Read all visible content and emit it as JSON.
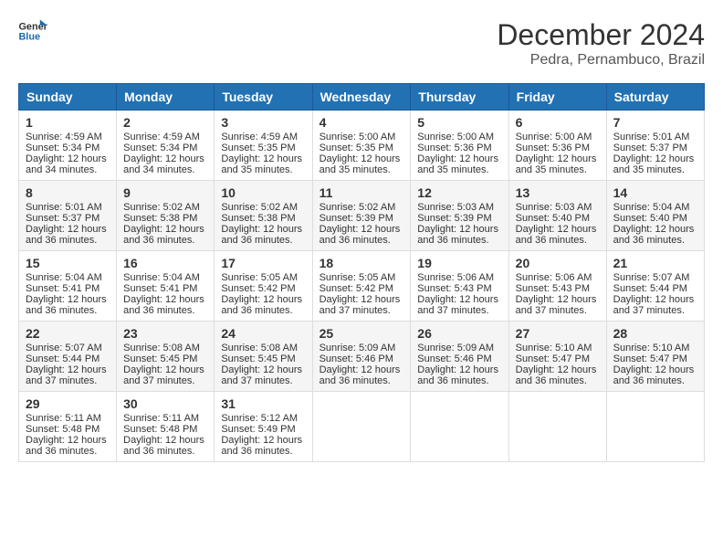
{
  "logo": {
    "line1": "General",
    "line2": "Blue"
  },
  "title": {
    "month": "December 2024",
    "location": "Pedra, Pernambuco, Brazil"
  },
  "headers": [
    "Sunday",
    "Monday",
    "Tuesday",
    "Wednesday",
    "Thursday",
    "Friday",
    "Saturday"
  ],
  "weeks": [
    [
      {
        "day": 1,
        "sunrise": "4:59 AM",
        "sunset": "5:34 PM",
        "daylight": "12 hours and 34 minutes."
      },
      {
        "day": 2,
        "sunrise": "4:59 AM",
        "sunset": "5:34 PM",
        "daylight": "12 hours and 34 minutes."
      },
      {
        "day": 3,
        "sunrise": "4:59 AM",
        "sunset": "5:35 PM",
        "daylight": "12 hours and 35 minutes."
      },
      {
        "day": 4,
        "sunrise": "5:00 AM",
        "sunset": "5:35 PM",
        "daylight": "12 hours and 35 minutes."
      },
      {
        "day": 5,
        "sunrise": "5:00 AM",
        "sunset": "5:36 PM",
        "daylight": "12 hours and 35 minutes."
      },
      {
        "day": 6,
        "sunrise": "5:00 AM",
        "sunset": "5:36 PM",
        "daylight": "12 hours and 35 minutes."
      },
      {
        "day": 7,
        "sunrise": "5:01 AM",
        "sunset": "5:37 PM",
        "daylight": "12 hours and 35 minutes."
      }
    ],
    [
      {
        "day": 8,
        "sunrise": "5:01 AM",
        "sunset": "5:37 PM",
        "daylight": "12 hours and 36 minutes."
      },
      {
        "day": 9,
        "sunrise": "5:02 AM",
        "sunset": "5:38 PM",
        "daylight": "12 hours and 36 minutes."
      },
      {
        "day": 10,
        "sunrise": "5:02 AM",
        "sunset": "5:38 PM",
        "daylight": "12 hours and 36 minutes."
      },
      {
        "day": 11,
        "sunrise": "5:02 AM",
        "sunset": "5:39 PM",
        "daylight": "12 hours and 36 minutes."
      },
      {
        "day": 12,
        "sunrise": "5:03 AM",
        "sunset": "5:39 PM",
        "daylight": "12 hours and 36 minutes."
      },
      {
        "day": 13,
        "sunrise": "5:03 AM",
        "sunset": "5:40 PM",
        "daylight": "12 hours and 36 minutes."
      },
      {
        "day": 14,
        "sunrise": "5:04 AM",
        "sunset": "5:40 PM",
        "daylight": "12 hours and 36 minutes."
      }
    ],
    [
      {
        "day": 15,
        "sunrise": "5:04 AM",
        "sunset": "5:41 PM",
        "daylight": "12 hours and 36 minutes."
      },
      {
        "day": 16,
        "sunrise": "5:04 AM",
        "sunset": "5:41 PM",
        "daylight": "12 hours and 36 minutes."
      },
      {
        "day": 17,
        "sunrise": "5:05 AM",
        "sunset": "5:42 PM",
        "daylight": "12 hours and 36 minutes."
      },
      {
        "day": 18,
        "sunrise": "5:05 AM",
        "sunset": "5:42 PM",
        "daylight": "12 hours and 37 minutes."
      },
      {
        "day": 19,
        "sunrise": "5:06 AM",
        "sunset": "5:43 PM",
        "daylight": "12 hours and 37 minutes."
      },
      {
        "day": 20,
        "sunrise": "5:06 AM",
        "sunset": "5:43 PM",
        "daylight": "12 hours and 37 minutes."
      },
      {
        "day": 21,
        "sunrise": "5:07 AM",
        "sunset": "5:44 PM",
        "daylight": "12 hours and 37 minutes."
      }
    ],
    [
      {
        "day": 22,
        "sunrise": "5:07 AM",
        "sunset": "5:44 PM",
        "daylight": "12 hours and 37 minutes."
      },
      {
        "day": 23,
        "sunrise": "5:08 AM",
        "sunset": "5:45 PM",
        "daylight": "12 hours and 37 minutes."
      },
      {
        "day": 24,
        "sunrise": "5:08 AM",
        "sunset": "5:45 PM",
        "daylight": "12 hours and 37 minutes."
      },
      {
        "day": 25,
        "sunrise": "5:09 AM",
        "sunset": "5:46 PM",
        "daylight": "12 hours and 36 minutes."
      },
      {
        "day": 26,
        "sunrise": "5:09 AM",
        "sunset": "5:46 PM",
        "daylight": "12 hours and 36 minutes."
      },
      {
        "day": 27,
        "sunrise": "5:10 AM",
        "sunset": "5:47 PM",
        "daylight": "12 hours and 36 minutes."
      },
      {
        "day": 28,
        "sunrise": "5:10 AM",
        "sunset": "5:47 PM",
        "daylight": "12 hours and 36 minutes."
      }
    ],
    [
      {
        "day": 29,
        "sunrise": "5:11 AM",
        "sunset": "5:48 PM",
        "daylight": "12 hours and 36 minutes."
      },
      {
        "day": 30,
        "sunrise": "5:11 AM",
        "sunset": "5:48 PM",
        "daylight": "12 hours and 36 minutes."
      },
      {
        "day": 31,
        "sunrise": "5:12 AM",
        "sunset": "5:49 PM",
        "daylight": "12 hours and 36 minutes."
      },
      null,
      null,
      null,
      null
    ]
  ],
  "labels": {
    "sunrise": "Sunrise: ",
    "sunset": "Sunset: ",
    "daylight": "Daylight: "
  }
}
